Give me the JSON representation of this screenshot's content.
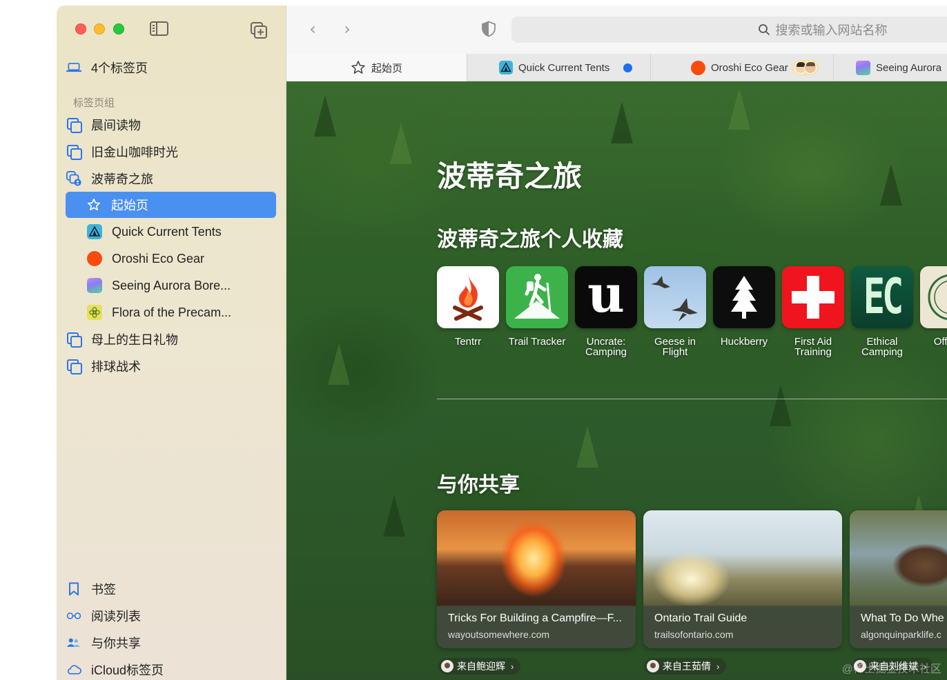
{
  "window": {
    "traffic_lights": {
      "close_color": "#fe5f57",
      "minimize_color": "#febc2e",
      "zoom_color": "#28c840"
    }
  },
  "sidebar": {
    "tabs_count_label": "4个标签页",
    "section_title": "标签页组",
    "groups": [
      {
        "label": "晨间读物",
        "icon": "tab-group-icon"
      },
      {
        "label": "旧金山咖啡时光",
        "icon": "tab-group-icon"
      },
      {
        "label": "波蒂奇之旅",
        "icon": "shared-tab-group-icon"
      }
    ],
    "group_tabs": [
      {
        "label": "起始页",
        "icon": "star-icon",
        "selected": true
      },
      {
        "label": "Quick Current Tents",
        "icon": "tent-favicon"
      },
      {
        "label": "Oroshi Eco Gear",
        "icon": "orange-circle-favicon"
      },
      {
        "label": "Seeing Aurora Bore...",
        "icon": "aurora-favicon"
      },
      {
        "label": "Flora of the Precam...",
        "icon": "flower-favicon"
      }
    ],
    "more_groups": [
      {
        "label": "母上的生日礼物",
        "icon": "tab-group-icon"
      },
      {
        "label": "排球战术",
        "icon": "tab-group-icon"
      }
    ],
    "bottom": [
      {
        "label": "书签",
        "icon": "bookmark-icon"
      },
      {
        "label": "阅读列表",
        "icon": "glasses-icon"
      },
      {
        "label": "与你共享",
        "icon": "shared-people-icon"
      },
      {
        "label": "iCloud标签页",
        "icon": "cloud-icon"
      }
    ],
    "accent": "#4a90f0"
  },
  "toolbar": {
    "search_placeholder": "搜索或输入网站名称"
  },
  "tabs": [
    {
      "label": "起始页",
      "icon": "star-icon",
      "active": true
    },
    {
      "label": "Quick Current Tents",
      "icon": "tent-favicon"
    },
    {
      "label": "Oroshi Eco Gear",
      "icon": "orange-circle-favicon"
    },
    {
      "label": "Seeing Aurora",
      "icon": "aurora-favicon"
    }
  ],
  "start_page": {
    "title": "波蒂奇之旅",
    "favorites_title": "波蒂奇之旅个人收藏",
    "favorites": [
      {
        "name": "Tentrr",
        "icon": "campfire-icon"
      },
      {
        "name": "Trail Tracker",
        "icon": "hiker-icon"
      },
      {
        "name": "Uncrate: Camping",
        "icon": "letter-u-icon"
      },
      {
        "name": "Geese in Flight",
        "icon": "geese-icon"
      },
      {
        "name": "Huckberry",
        "icon": "pine-tree-icon"
      },
      {
        "name": "First Aid Training",
        "icon": "red-cross-icon"
      },
      {
        "name": "Ethical Camping",
        "icon": "ec-logo-icon"
      },
      {
        "name": "Off Rev",
        "icon": "compass-icon"
      }
    ],
    "shared_title": "与你共享",
    "shared": [
      {
        "title": "Tricks For Building a Campfire—F...",
        "domain": "wayoutsomewhere.com",
        "from": "来自鲍迎辉"
      },
      {
        "title": "Ontario Trail Guide",
        "domain": "trailsofontario.com",
        "from": "来自王茹倩"
      },
      {
        "title": "What To Do Whe",
        "domain": "algonquinparklife.c",
        "from": "来自刘维斌"
      }
    ]
  },
  "watermark": "@稀土掘金技术社区"
}
